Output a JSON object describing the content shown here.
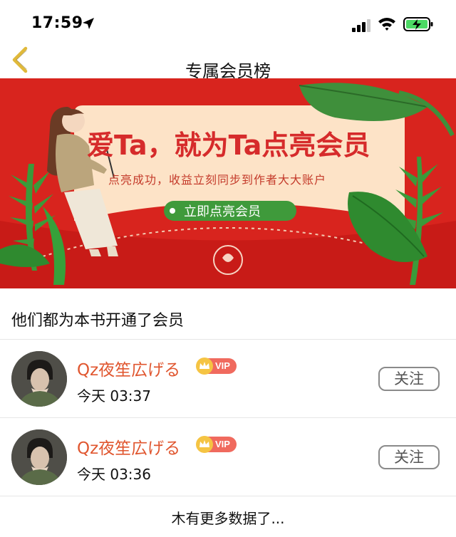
{
  "status_bar": {
    "time": "17:59",
    "icons": [
      "location-arrow-icon",
      "signal-icon",
      "wifi-icon",
      "battery-charging-icon"
    ]
  },
  "nav": {
    "back_icon": "chevron-left-icon",
    "title": "专属会员榜",
    "accent_color": "#e0b93a"
  },
  "banner": {
    "headline": "爱Ta，就为Ta点亮会员",
    "subline": "点亮成功，收益立刻同步到作者大大账户",
    "cta_label": "立即点亮会员",
    "colors": {
      "background": "#d8241e",
      "card": "#fde3c7",
      "headline": "#d62b2b",
      "cta": "#3f9a3b"
    }
  },
  "section": {
    "title": "他们都为本书开通了会员"
  },
  "members": [
    {
      "name": "Qz夜笙広げる",
      "badge": "VIP",
      "time": "今天 03:37",
      "follow_label": "关注"
    },
    {
      "name": "Qz夜笙広げる",
      "badge": "VIP",
      "time": "今天 03:36",
      "follow_label": "关注"
    }
  ],
  "footer": {
    "text": "木有更多数据了..."
  }
}
